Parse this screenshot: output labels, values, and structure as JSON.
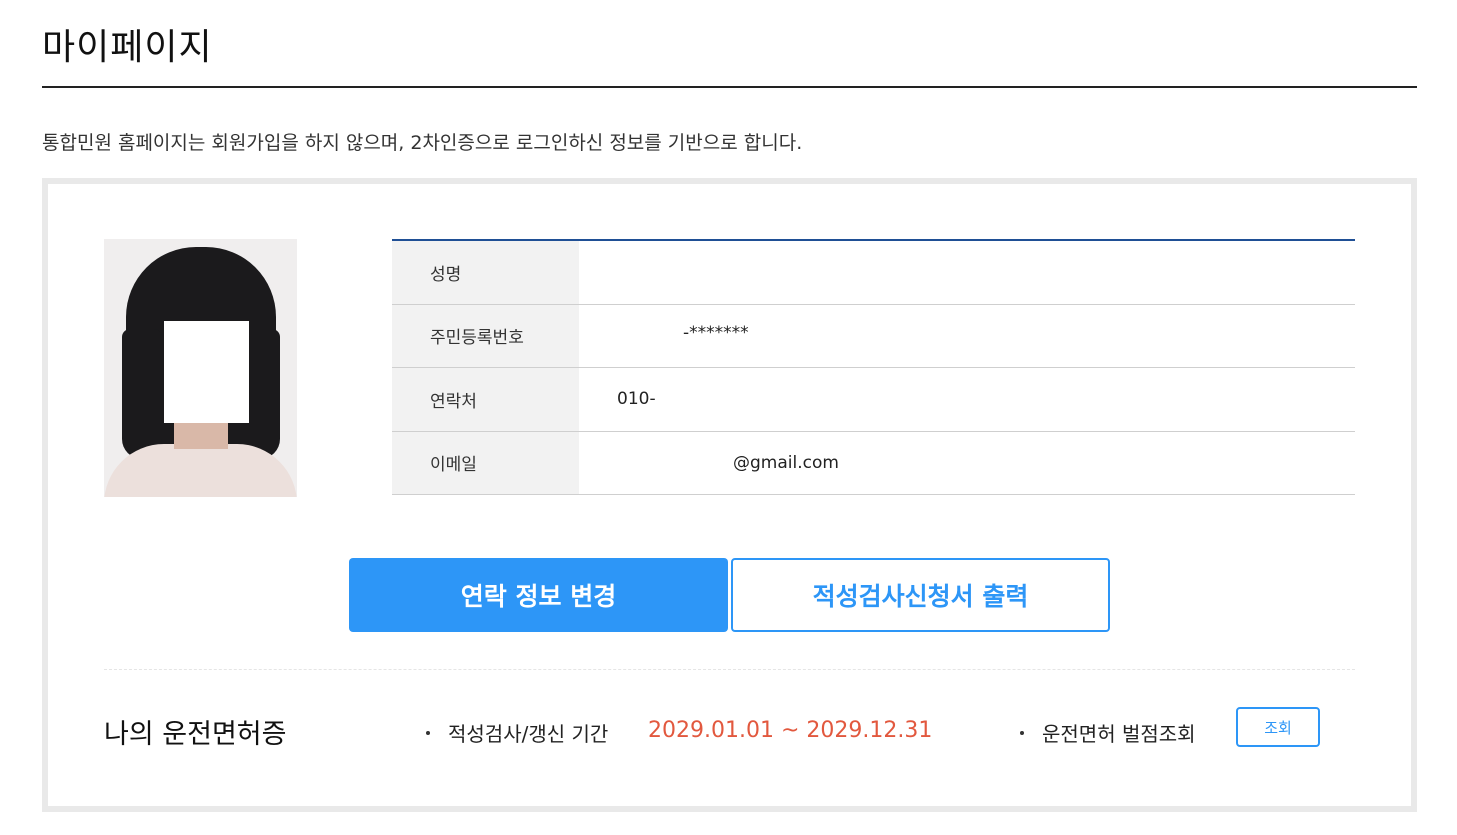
{
  "page": {
    "title": "마이페이지",
    "notice": "통합민원 홈페이지는 회원가입을 하지 않으며, 2차인증으로 로그인하신 정보를 기반으로 합니다."
  },
  "profile": {
    "rows": [
      {
        "label": "성명",
        "value": ""
      },
      {
        "label": "주민등록번호",
        "value": "-*******"
      },
      {
        "label": "연락처",
        "value": "010-"
      },
      {
        "label": "이메일",
        "value": "@gmail.com"
      }
    ]
  },
  "actions": {
    "change_contact": "연락 정보 변경",
    "print_application": "적성검사신청서 출력"
  },
  "license": {
    "title": "나의 운전면허증",
    "period_label": "적성검사/갱신 기간",
    "period_value": "2029.01.01 ~ 2029.12.31",
    "penalty_label": "운전면허 벌점조회",
    "inquiry_button": "조회"
  },
  "colors": {
    "accent": "#2d96f7",
    "table_top": "#1f4f95",
    "period": "#e2583e"
  }
}
